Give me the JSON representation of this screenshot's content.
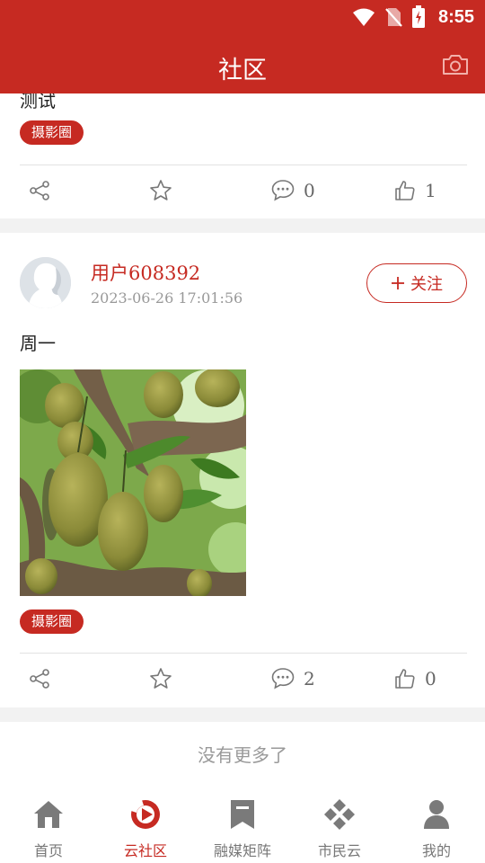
{
  "status_bar": {
    "time": "8:55"
  },
  "header": {
    "title": "社区"
  },
  "posts": [
    {
      "text": "测试",
      "tag": "摄影圈",
      "comments": "0",
      "likes": "1"
    },
    {
      "username": "用户608392",
      "timestamp": "2023-06-26 17:01:56",
      "follow_label": "关注",
      "text": "周一",
      "tag": "摄影圈",
      "comments": "2",
      "likes": "0"
    }
  ],
  "footer_note": "没有更多了",
  "tabbar": {
    "items": [
      {
        "label": "首页",
        "icon": "home-icon"
      },
      {
        "label": "云社区",
        "icon": "community-icon",
        "active": true
      },
      {
        "label": "融媒矩阵",
        "icon": "bookmark-icon"
      },
      {
        "label": "市民云",
        "icon": "citizen-cloud-icon"
      },
      {
        "label": "我的",
        "icon": "user-icon"
      }
    ]
  },
  "colors": {
    "brand": "#c62a22",
    "icon_gray": "#777777",
    "divider": "#e2e2e2",
    "band": "#f2f2f2"
  }
}
